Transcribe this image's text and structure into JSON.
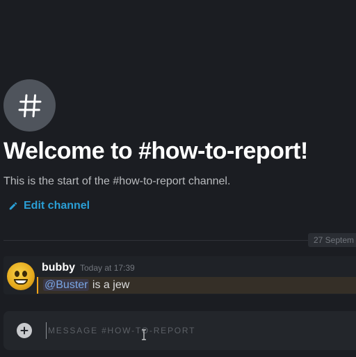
{
  "channel": {
    "welcome_title": "Welcome to #how-to-report!",
    "welcome_subtitle": "This is the start of the #how-to-report channel.",
    "edit_label": "Edit channel",
    "hash_icon": "hash-icon",
    "edit_icon": "pencil-icon"
  },
  "divider": {
    "date_label": "27 Septem"
  },
  "message": {
    "author": "bubby",
    "timestamp": "Today at 17:39",
    "mention": "@Buster",
    "text": " is a jew",
    "avatar_icon": "emoji-avatar"
  },
  "composer": {
    "placeholder": "MESSAGE #HOW-TO-REPORT",
    "value": "",
    "add_icon": "plus-circle-icon"
  },
  "colors": {
    "background": "#1b1d22",
    "accent_link": "#2a9fd6",
    "mention_highlight_border": "#faa61a",
    "mention_text": "#7aa6e6"
  }
}
